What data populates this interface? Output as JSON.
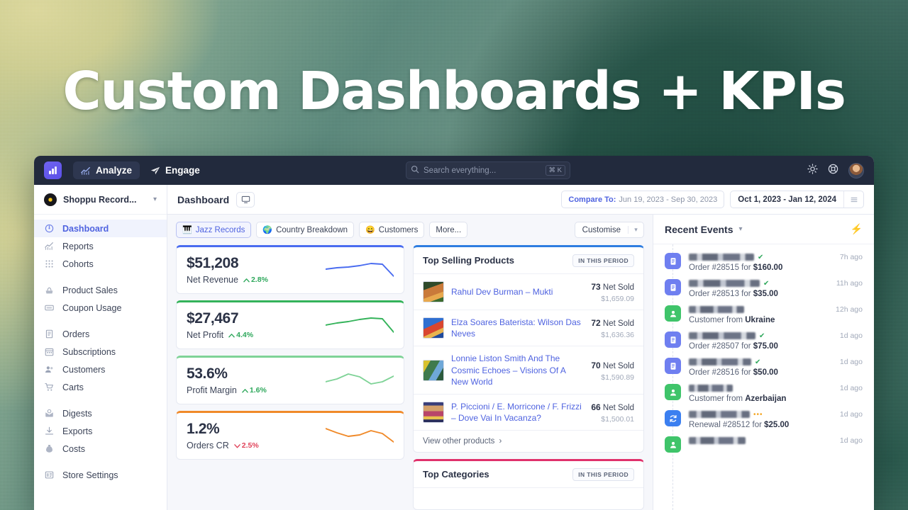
{
  "hero": {
    "title": "Custom Dashboards + KPIs"
  },
  "topbar": {
    "nav": [
      {
        "label": "Analyze",
        "icon": "chart-icon",
        "active": true
      },
      {
        "label": "Engage",
        "icon": "paper-plane-icon",
        "active": false
      }
    ],
    "search": {
      "placeholder": "Search everything...",
      "value": "",
      "shortcut": "⌘ K"
    },
    "icons": [
      "sun-icon",
      "lifebuoy-icon",
      "avatar"
    ]
  },
  "sidebar": {
    "store": {
      "name": "Shoppu Record...",
      "icon": "vinyl-record-icon"
    },
    "groups": [
      {
        "items": [
          {
            "label": "Dashboard",
            "icon": "gauge-icon",
            "active": true
          },
          {
            "label": "Reports",
            "icon": "chart-line-icon",
            "active": false
          },
          {
            "label": "Cohorts",
            "icon": "grid-dots-icon",
            "active": false
          }
        ]
      },
      {
        "items": [
          {
            "label": "Product Sales",
            "icon": "product-icon",
            "active": false
          },
          {
            "label": "Coupon Usage",
            "icon": "coupon-icon",
            "active": false
          }
        ]
      },
      {
        "items": [
          {
            "label": "Orders",
            "icon": "receipt-icon",
            "active": false
          },
          {
            "label": "Subscriptions",
            "icon": "calendar-icon",
            "active": false
          },
          {
            "label": "Customers",
            "icon": "users-icon",
            "active": false
          },
          {
            "label": "Carts",
            "icon": "cart-icon",
            "active": false
          }
        ]
      },
      {
        "items": [
          {
            "label": "Digests",
            "icon": "envelope-icon",
            "active": false
          },
          {
            "label": "Exports",
            "icon": "download-icon",
            "active": false
          },
          {
            "label": "Costs",
            "icon": "money-bag-icon",
            "active": false
          }
        ]
      },
      {
        "items": [
          {
            "label": "Store Settings",
            "icon": "store-settings-icon",
            "active": false
          }
        ]
      }
    ]
  },
  "main": {
    "page_title": "Dashboard",
    "display_icon": "monitor-icon",
    "compare": {
      "prefix": "Compare To:",
      "range": "Jun 19, 2023 - Sep 30, 2023"
    },
    "date_range": "Oct 1, 2023 - Jan 12, 2024",
    "menu_icon": "hamburger-icon",
    "chips": [
      {
        "label": "Jazz Records",
        "emoji": "🎹",
        "active": true
      },
      {
        "label": "Country Breakdown",
        "emoji": "🌍",
        "active": false
      },
      {
        "label": "Customers",
        "emoji": "😄",
        "active": false
      },
      {
        "label": "More...",
        "emoji": "",
        "active": false
      }
    ],
    "customise": {
      "label": "Customise",
      "chevron": "chevron-down-icon"
    }
  },
  "kpis": [
    {
      "value": "$51,208",
      "label": "Net Revenue",
      "delta": "2.8%",
      "direction": "up",
      "accent": "#4a6cf0",
      "spark": [
        16,
        14,
        13,
        11,
        8,
        9,
        26
      ]
    },
    {
      "value": "$27,467",
      "label": "Net Profit",
      "delta": "4.4%",
      "direction": "up",
      "accent": "#34b35a",
      "spark": [
        17,
        14,
        12,
        9,
        7,
        8,
        27
      ]
    },
    {
      "value": "53.6%",
      "label": "Profit Margin",
      "delta": "1.6%",
      "direction": "up",
      "accent": "#7fd397",
      "spark": [
        19,
        15,
        8,
        12,
        22,
        19,
        11
      ]
    },
    {
      "value": "1.2%",
      "label": "Orders CR",
      "delta": "2.5%",
      "direction": "down",
      "accent": "#f08a2a",
      "spark": [
        7,
        13,
        18,
        16,
        10,
        14,
        26
      ]
    }
  ],
  "top_products": {
    "title": "Top Selling Products",
    "badge": "IN THIS PERIOD",
    "footer": "View other products",
    "accent": "#2e7de0",
    "unit": "Net Sold",
    "rows": [
      {
        "name": "Rahul Dev Burman – Mukti",
        "sold": "73",
        "amount": "$1,659.09",
        "art": "art-1"
      },
      {
        "name": "Elza Soares Baterista: Wilson Das Neves",
        "sold": "72",
        "amount": "$1,636.36",
        "art": "art-2"
      },
      {
        "name": "Lonnie Liston Smith And The Cosmic Echoes – Visions Of A New World",
        "sold": "70",
        "amount": "$1,590.89",
        "art": "art-3"
      },
      {
        "name": "P. Piccioni / E. Morricone / F. Frizzi – Dove Vai In Vacanza?",
        "sold": "66",
        "amount": "$1,500.01",
        "art": "art-4"
      }
    ]
  },
  "top_categories": {
    "title": "Top Categories",
    "badge": "IN THIS PERIOD",
    "accent": "#e0316b"
  },
  "recent_events": {
    "title": "Recent Events",
    "chevron": "chevron-down-icon",
    "bolt": "lightning-bolt-icon",
    "items": [
      {
        "type": "order",
        "icon": "order-icon",
        "status": "check",
        "desc_prefix": "Order ",
        "ref": "#28515",
        "desc_mid": " for ",
        "amount": "$160.00",
        "time": "7h ago",
        "namewidth": 92
      },
      {
        "type": "order",
        "icon": "order-icon",
        "status": "check",
        "desc_prefix": "Order ",
        "ref": "#28513",
        "desc_mid": " for ",
        "amount": "$35.00",
        "time": "11h ago",
        "namewidth": 100
      },
      {
        "type": "customer",
        "icon": "customer-icon",
        "status": "none",
        "desc_prefix": "Customer from ",
        "ref": "",
        "desc_mid": "",
        "amount": "Ukraine",
        "time": "12h ago",
        "namewidth": 78
      },
      {
        "type": "order",
        "icon": "order-icon",
        "status": "check",
        "desc_prefix": "Order ",
        "ref": "#28507",
        "desc_mid": " for ",
        "amount": "$75.00",
        "time": "1d ago",
        "namewidth": 94
      },
      {
        "type": "order",
        "icon": "order-icon",
        "status": "check",
        "desc_prefix": "Order ",
        "ref": "#28516",
        "desc_mid": " for ",
        "amount": "$50.00",
        "time": "1d ago",
        "namewidth": 88
      },
      {
        "type": "customer",
        "icon": "customer-icon",
        "status": "none",
        "desc_prefix": "Customer from ",
        "ref": "",
        "desc_mid": "",
        "amount": "Azerbaijan",
        "time": "1d ago",
        "namewidth": 62
      },
      {
        "type": "renewal",
        "icon": "renewal-icon",
        "status": "dots",
        "desc_prefix": "Renewal ",
        "ref": "#28512",
        "desc_mid": " for ",
        "amount": "$25.00",
        "time": "1d ago",
        "namewidth": 86
      },
      {
        "type": "customer",
        "icon": "customer-icon",
        "status": "none",
        "desc_prefix": "",
        "ref": "",
        "desc_mid": "",
        "amount": "",
        "time": "1d ago",
        "namewidth": 80
      }
    ]
  }
}
